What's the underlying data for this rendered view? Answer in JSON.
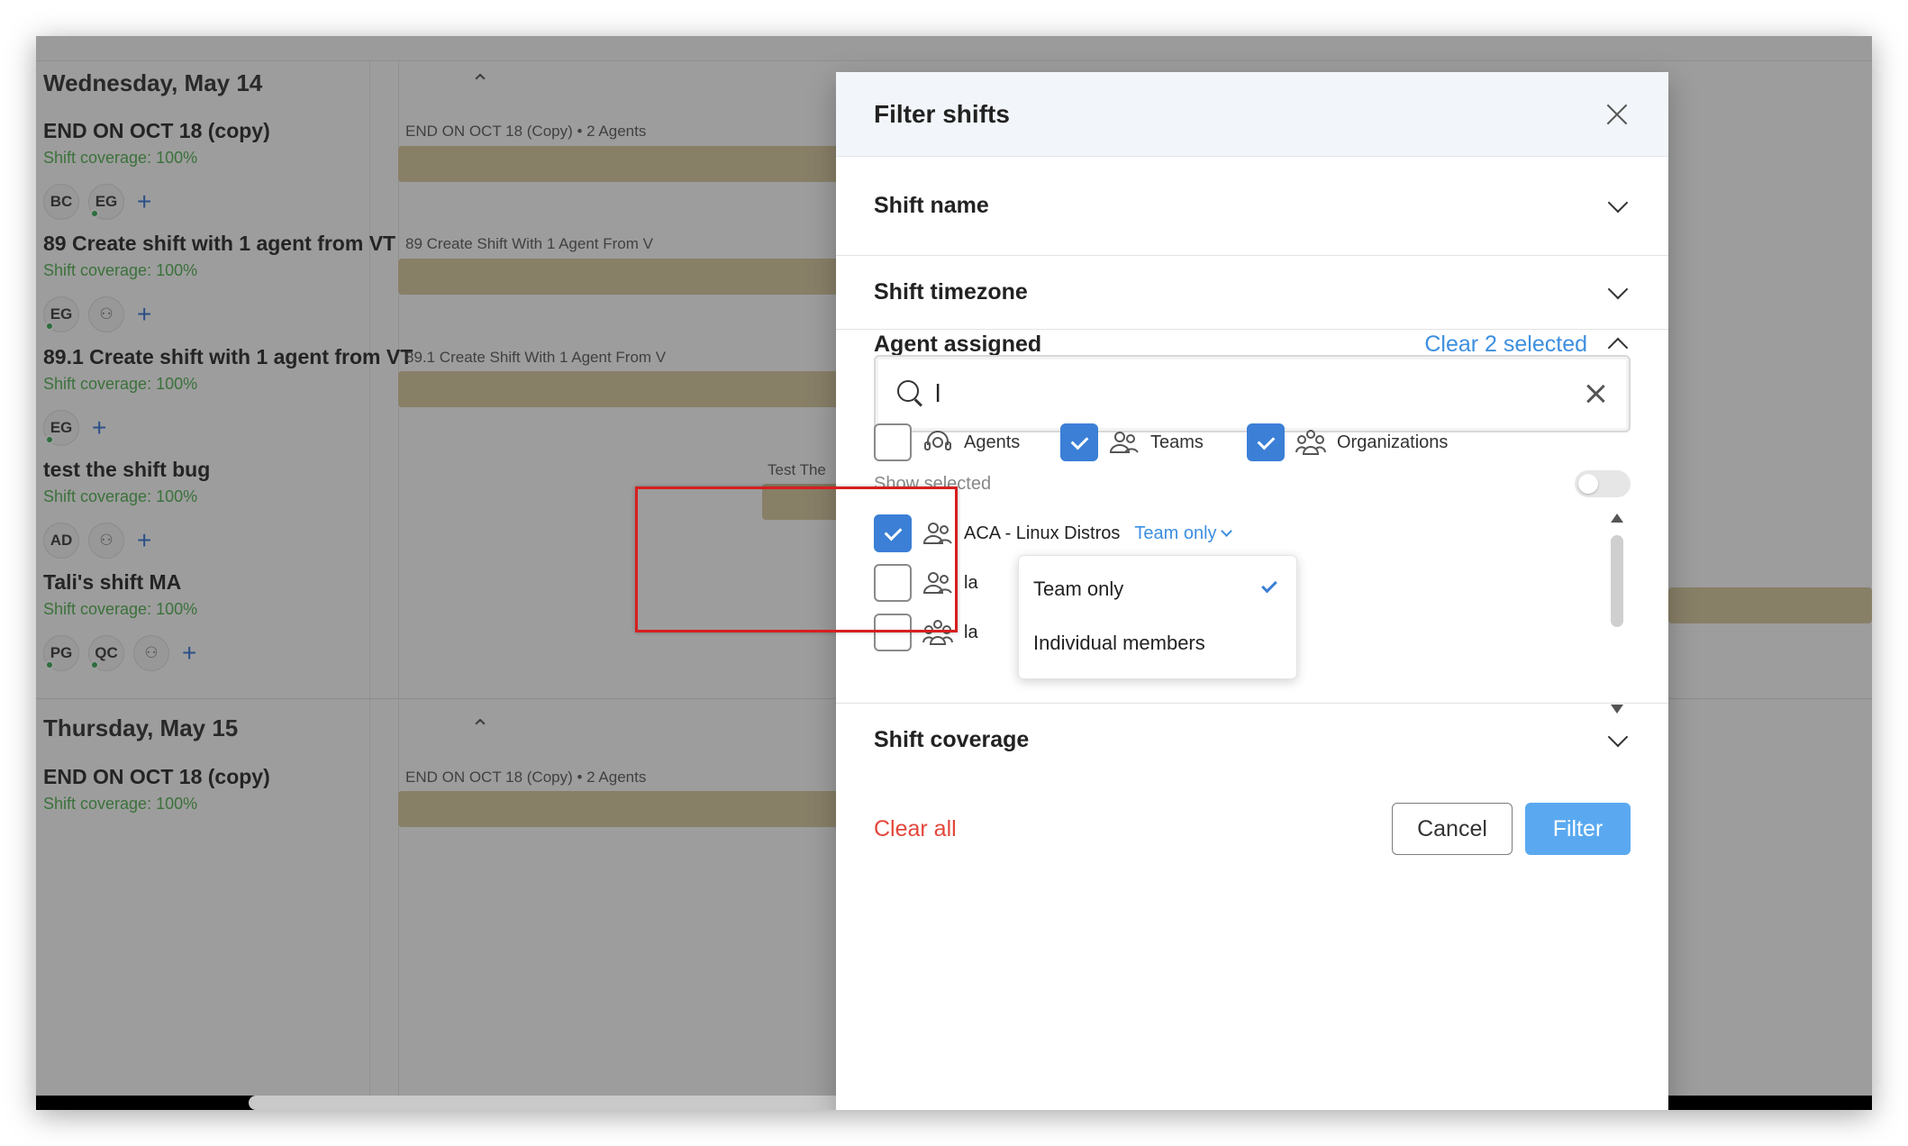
{
  "background": {
    "days": [
      {
        "title": "Wednesday, May 14",
        "shifts": [
          {
            "name": "END ON OCT 18 (copy)",
            "coverage": "Shift coverage: 100%",
            "avatars": [
              "BC",
              "EG"
            ],
            "timeline_label": "END ON OCT 18 (Copy) • 2 Agents"
          },
          {
            "name": "89 Create shift with 1 agent from VT",
            "coverage": "Shift coverage: 100%",
            "avatars": [
              "EG"
            ],
            "timeline_label": "89 Create Shift With 1 Agent From V"
          },
          {
            "name": "89.1 Create shift with 1 agent from VT",
            "coverage": "Shift coverage: 100%",
            "avatars": [
              "EG"
            ],
            "timeline_label": "89.1 Create Shift With 1 Agent From V"
          },
          {
            "name": "test the shift bug",
            "coverage": "Shift coverage: 100%",
            "avatars": [
              "AD"
            ],
            "timeline_label": "Test The"
          },
          {
            "name": "Tali's shift MA",
            "coverage": "Shift coverage: 100%",
            "avatars": [
              "PG",
              "QC"
            ],
            "timeline_label": ""
          }
        ]
      },
      {
        "title": "Thursday, May 15",
        "shifts": [
          {
            "name": "END ON OCT 18 (copy)",
            "coverage": "Shift coverage: 100%",
            "avatars": [],
            "timeline_label": "END ON OCT 18 (Copy) • 2 Agents"
          }
        ]
      }
    ]
  },
  "modal": {
    "title": "Filter shifts",
    "sections": {
      "shift_name": "Shift name",
      "shift_timezone": "Shift timezone",
      "agent_assigned": "Agent assigned",
      "clear_selected": "Clear 2 selected",
      "shift_coverage": "Shift coverage"
    },
    "search": {
      "value": "l"
    },
    "types": [
      {
        "label": "Agents",
        "checked": false
      },
      {
        "label": "Teams",
        "checked": true
      },
      {
        "label": "Organizations",
        "checked": true
      }
    ],
    "show_selected": {
      "label": "Show selected",
      "on": false
    },
    "results": [
      {
        "label": "ACA - Linux Distros",
        "checked": true,
        "mode": "Team only",
        "icon": "team-icon"
      },
      {
        "label": "la",
        "checked": false,
        "icon": "team-icon"
      },
      {
        "label": "la",
        "checked": false,
        "icon": "organization-icon"
      }
    ],
    "mode_dropdown": {
      "options": [
        "Team only",
        "Individual members"
      ],
      "selected": "Team only"
    },
    "footer": {
      "clear_all": "Clear all",
      "cancel": "Cancel",
      "filter": "Filter"
    }
  },
  "colors": {
    "accent": "#3b7fd6",
    "link": "#3d8fe0",
    "danger": "#e2463b",
    "coverage": "#4cae4c",
    "highlight": "#d81e1e"
  }
}
